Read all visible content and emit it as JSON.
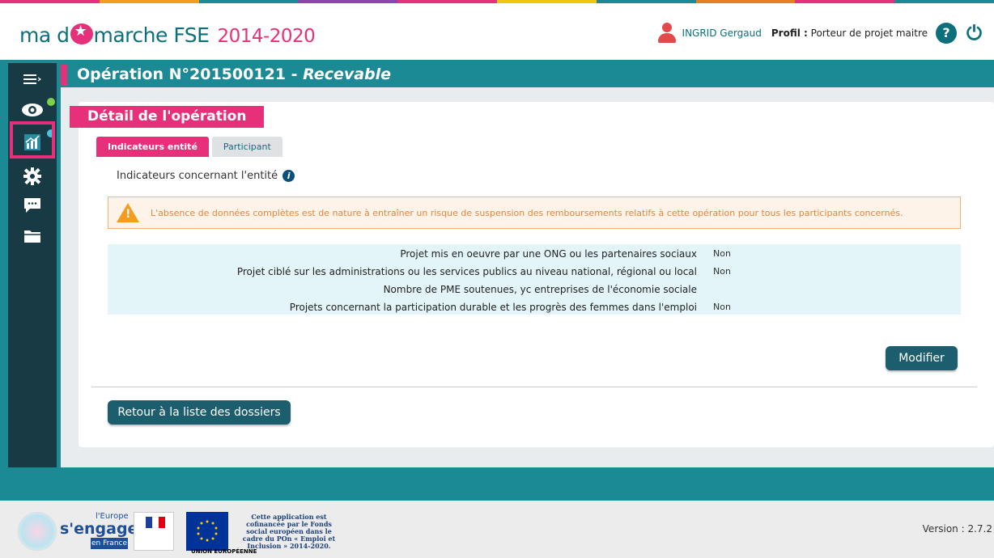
{
  "header": {
    "logo_main": "ma d",
    "logo_rest": "marche FSE",
    "logo_years": "2014-2020",
    "user_name": "INGRID Gergaud",
    "profile_label": "Profil :",
    "profile_value": "Porteur de projet maitre",
    "help_label": "?"
  },
  "page": {
    "title_prefix": "Opération N°201500121 - ",
    "title_status": "Recevable",
    "section_title": "Détail de l'opération"
  },
  "tabs": [
    {
      "label": "Indicateurs entité",
      "active": true
    },
    {
      "label": "Participant",
      "active": false
    }
  ],
  "indicators": {
    "title": "Indicateurs concernant l'entité",
    "info_glyph": "i",
    "alert_text": "L'absence de données complètes est de nature à entraîner un risque de suspension des remboursements relatifs à cette opération pour tous les participants concernés.",
    "rows": [
      {
        "label": "Projet mis en oeuvre par une ONG ou les partenaires sociaux",
        "value": "Non"
      },
      {
        "label": "Projet ciblé sur les administrations ou les services publics au niveau national, régional ou local",
        "value": "Non"
      },
      {
        "label": "Nombre de PME soutenues, yc entreprises de l'économie sociale",
        "value": ""
      },
      {
        "label": "Projets concernant la participation durable et les progrès des femmes dans l'emploi",
        "value": "Non"
      }
    ]
  },
  "buttons": {
    "modify": "Modifier",
    "back": "Retour à la liste des dossiers"
  },
  "footer": {
    "europe_small": "l'Europe",
    "engage_text": "s'engage",
    "en_france": "en France",
    "eu_caption": "UNION EUROPÉENNE",
    "fse_notice": "Cette application est cofinancée par le Fonds social européen dans le cadre du POn « Emploi et Inclusion » 2014-2020.",
    "version": "Version : 2.7.2"
  },
  "colors": {
    "brand_teal": "#1b8a95",
    "brand_pink": "#e6307a",
    "sidebar_dark": "#173a45",
    "button_dark": "#1c5d6e"
  }
}
